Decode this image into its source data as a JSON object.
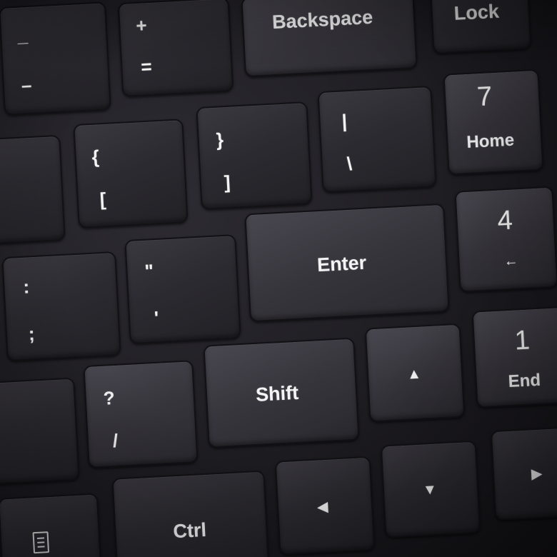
{
  "keyboard": {
    "keys": {
      "minus": {
        "top": "_",
        "bottom": "–"
      },
      "equals": {
        "top": "+",
        "bottom": "="
      },
      "backspace": {
        "label": "Backspace"
      },
      "numlock": {
        "label": "Lock"
      },
      "bracket_left": {
        "top": "{",
        "bottom": "["
      },
      "bracket_right": {
        "top": "}",
        "bottom": "]"
      },
      "backslash": {
        "top": "|",
        "bottom": "\\"
      },
      "num7": {
        "number": "7",
        "label": "Home"
      },
      "semicolon": {
        "top": ":",
        "bottom": ";"
      },
      "quote": {
        "top": "\"",
        "bottom": "'"
      },
      "enter": {
        "label": "Enter"
      },
      "num4": {
        "number": "4",
        "label": "←"
      },
      "slash": {
        "top": "?",
        "bottom": "/"
      },
      "shift": {
        "label": "Shift"
      },
      "arrow_up": {
        "glyph": "▲"
      },
      "num1": {
        "number": "1",
        "label": "End"
      },
      "ctrl": {
        "label": "Ctrl"
      },
      "arrow_left": {
        "glyph": "◀"
      },
      "arrow_down": {
        "glyph": "▼"
      },
      "arrow_right": {
        "glyph": "▶"
      },
      "menu": {
        "icon": "menu-icon"
      }
    },
    "colors": {
      "key_face": "#2c2b31",
      "legend": "#f2f2f2",
      "frame": "#1a191e"
    }
  }
}
